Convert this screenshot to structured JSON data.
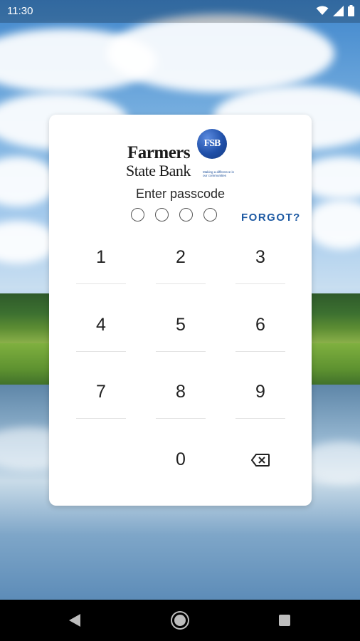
{
  "status_bar": {
    "time": "11:30",
    "icons": [
      "wifi-icon",
      "signal-icon",
      "battery-icon"
    ]
  },
  "logo": {
    "badge_text": "FSB",
    "line1": "Farmers",
    "line2": "State Bank",
    "tagline": "Making a difference in our communities"
  },
  "passcode": {
    "prompt": "Enter passcode",
    "dot_count": 4,
    "filled": 0,
    "forgot_label": "FORGOT?"
  },
  "keypad": {
    "keys": [
      "1",
      "2",
      "3",
      "4",
      "5",
      "6",
      "7",
      "8",
      "9",
      "0"
    ],
    "backspace_icon": "backspace-icon"
  },
  "nav_bar": {
    "icons": [
      "back-icon",
      "home-icon",
      "recents-icon"
    ]
  },
  "colors": {
    "accent": "#1e5aa3",
    "card": "#ffffff",
    "nav": "#000000"
  }
}
